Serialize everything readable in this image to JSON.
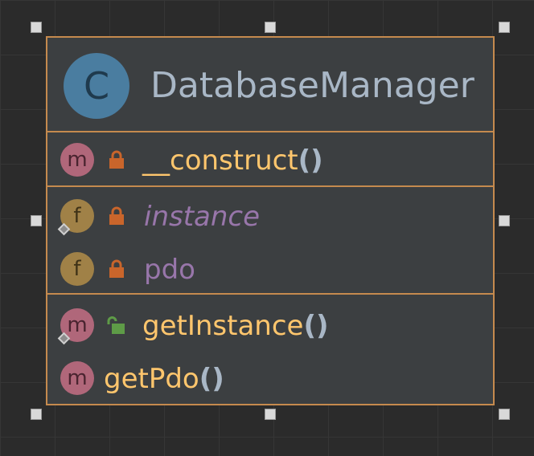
{
  "diagram": {
    "class": {
      "icon_letter": "C",
      "name": "DatabaseManager"
    },
    "constructor_section": [
      {
        "kind_letter": "m",
        "visibility": "private",
        "static": false,
        "name": "__construct",
        "parens": "()"
      }
    ],
    "fields": [
      {
        "kind_letter": "f",
        "visibility": "private",
        "static": true,
        "italic": true,
        "name": "instance"
      },
      {
        "kind_letter": "f",
        "visibility": "private",
        "static": false,
        "italic": false,
        "name": "pdo"
      }
    ],
    "methods": [
      {
        "kind_letter": "m",
        "visibility": "public",
        "static": true,
        "name": "getInstance",
        "parens": "()"
      },
      {
        "kind_letter": "m",
        "visibility": "none",
        "static": false,
        "name": "getPdo",
        "parens": "()"
      }
    ]
  },
  "colors": {
    "border": "#c58a4e",
    "class_icon": "#4a7da0",
    "method_badge": "#b0677a",
    "field_badge": "#a08147",
    "method_name": "#ffc66d",
    "field_name": "#9876aa",
    "private_lock": "#c9652b",
    "public_lock": "#5e9b47"
  }
}
